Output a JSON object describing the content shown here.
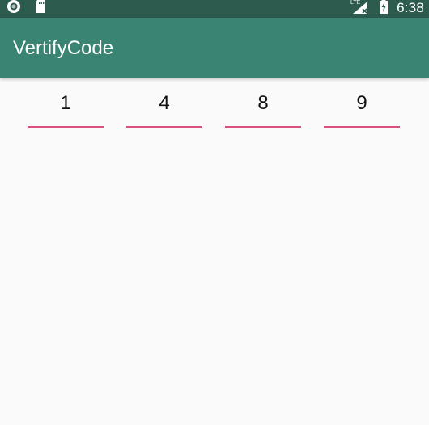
{
  "status_bar": {
    "time": "6:38",
    "left_icons": [
      "record-icon",
      "sd-card-icon"
    ],
    "right_icons": [
      "signal-lte-icon",
      "battery-charging-icon"
    ]
  },
  "app_bar": {
    "title": "VertifyCode",
    "color": "#3a8473"
  },
  "verify_code": {
    "digits": [
      "1",
      "4",
      "8",
      "9"
    ],
    "underline_color": "#d9507e"
  }
}
